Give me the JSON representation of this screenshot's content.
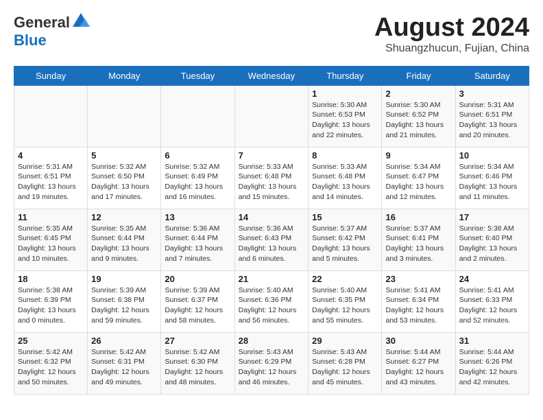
{
  "header": {
    "logo_general": "General",
    "logo_blue": "Blue",
    "month_year": "August 2024",
    "location": "Shuangzhucun, Fujian, China"
  },
  "days_of_week": [
    "Sunday",
    "Monday",
    "Tuesday",
    "Wednesday",
    "Thursday",
    "Friday",
    "Saturday"
  ],
  "weeks": [
    [
      {
        "day": "",
        "info": ""
      },
      {
        "day": "",
        "info": ""
      },
      {
        "day": "",
        "info": ""
      },
      {
        "day": "",
        "info": ""
      },
      {
        "day": "1",
        "info": "Sunrise: 5:30 AM\nSunset: 6:53 PM\nDaylight: 13 hours and 22 minutes."
      },
      {
        "day": "2",
        "info": "Sunrise: 5:30 AM\nSunset: 6:52 PM\nDaylight: 13 hours and 21 minutes."
      },
      {
        "day": "3",
        "info": "Sunrise: 5:31 AM\nSunset: 6:51 PM\nDaylight: 13 hours and 20 minutes."
      }
    ],
    [
      {
        "day": "4",
        "info": "Sunrise: 5:31 AM\nSunset: 6:51 PM\nDaylight: 13 hours and 19 minutes."
      },
      {
        "day": "5",
        "info": "Sunrise: 5:32 AM\nSunset: 6:50 PM\nDaylight: 13 hours and 17 minutes."
      },
      {
        "day": "6",
        "info": "Sunrise: 5:32 AM\nSunset: 6:49 PM\nDaylight: 13 hours and 16 minutes."
      },
      {
        "day": "7",
        "info": "Sunrise: 5:33 AM\nSunset: 6:48 PM\nDaylight: 13 hours and 15 minutes."
      },
      {
        "day": "8",
        "info": "Sunrise: 5:33 AM\nSunset: 6:48 PM\nDaylight: 13 hours and 14 minutes."
      },
      {
        "day": "9",
        "info": "Sunrise: 5:34 AM\nSunset: 6:47 PM\nDaylight: 13 hours and 12 minutes."
      },
      {
        "day": "10",
        "info": "Sunrise: 5:34 AM\nSunset: 6:46 PM\nDaylight: 13 hours and 11 minutes."
      }
    ],
    [
      {
        "day": "11",
        "info": "Sunrise: 5:35 AM\nSunset: 6:45 PM\nDaylight: 13 hours and 10 minutes."
      },
      {
        "day": "12",
        "info": "Sunrise: 5:35 AM\nSunset: 6:44 PM\nDaylight: 13 hours and 9 minutes."
      },
      {
        "day": "13",
        "info": "Sunrise: 5:36 AM\nSunset: 6:44 PM\nDaylight: 13 hours and 7 minutes."
      },
      {
        "day": "14",
        "info": "Sunrise: 5:36 AM\nSunset: 6:43 PM\nDaylight: 13 hours and 6 minutes."
      },
      {
        "day": "15",
        "info": "Sunrise: 5:37 AM\nSunset: 6:42 PM\nDaylight: 13 hours and 5 minutes."
      },
      {
        "day": "16",
        "info": "Sunrise: 5:37 AM\nSunset: 6:41 PM\nDaylight: 13 hours and 3 minutes."
      },
      {
        "day": "17",
        "info": "Sunrise: 5:38 AM\nSunset: 6:40 PM\nDaylight: 13 hours and 2 minutes."
      }
    ],
    [
      {
        "day": "18",
        "info": "Sunrise: 5:38 AM\nSunset: 6:39 PM\nDaylight: 13 hours and 0 minutes."
      },
      {
        "day": "19",
        "info": "Sunrise: 5:39 AM\nSunset: 6:38 PM\nDaylight: 12 hours and 59 minutes."
      },
      {
        "day": "20",
        "info": "Sunrise: 5:39 AM\nSunset: 6:37 PM\nDaylight: 12 hours and 58 minutes."
      },
      {
        "day": "21",
        "info": "Sunrise: 5:40 AM\nSunset: 6:36 PM\nDaylight: 12 hours and 56 minutes."
      },
      {
        "day": "22",
        "info": "Sunrise: 5:40 AM\nSunset: 6:35 PM\nDaylight: 12 hours and 55 minutes."
      },
      {
        "day": "23",
        "info": "Sunrise: 5:41 AM\nSunset: 6:34 PM\nDaylight: 12 hours and 53 minutes."
      },
      {
        "day": "24",
        "info": "Sunrise: 5:41 AM\nSunset: 6:33 PM\nDaylight: 12 hours and 52 minutes."
      }
    ],
    [
      {
        "day": "25",
        "info": "Sunrise: 5:42 AM\nSunset: 6:32 PM\nDaylight: 12 hours and 50 minutes."
      },
      {
        "day": "26",
        "info": "Sunrise: 5:42 AM\nSunset: 6:31 PM\nDaylight: 12 hours and 49 minutes."
      },
      {
        "day": "27",
        "info": "Sunrise: 5:42 AM\nSunset: 6:30 PM\nDaylight: 12 hours and 48 minutes."
      },
      {
        "day": "28",
        "info": "Sunrise: 5:43 AM\nSunset: 6:29 PM\nDaylight: 12 hours and 46 minutes."
      },
      {
        "day": "29",
        "info": "Sunrise: 5:43 AM\nSunset: 6:28 PM\nDaylight: 12 hours and 45 minutes."
      },
      {
        "day": "30",
        "info": "Sunrise: 5:44 AM\nSunset: 6:27 PM\nDaylight: 12 hours and 43 minutes."
      },
      {
        "day": "31",
        "info": "Sunrise: 5:44 AM\nSunset: 6:26 PM\nDaylight: 12 hours and 42 minutes."
      }
    ]
  ]
}
